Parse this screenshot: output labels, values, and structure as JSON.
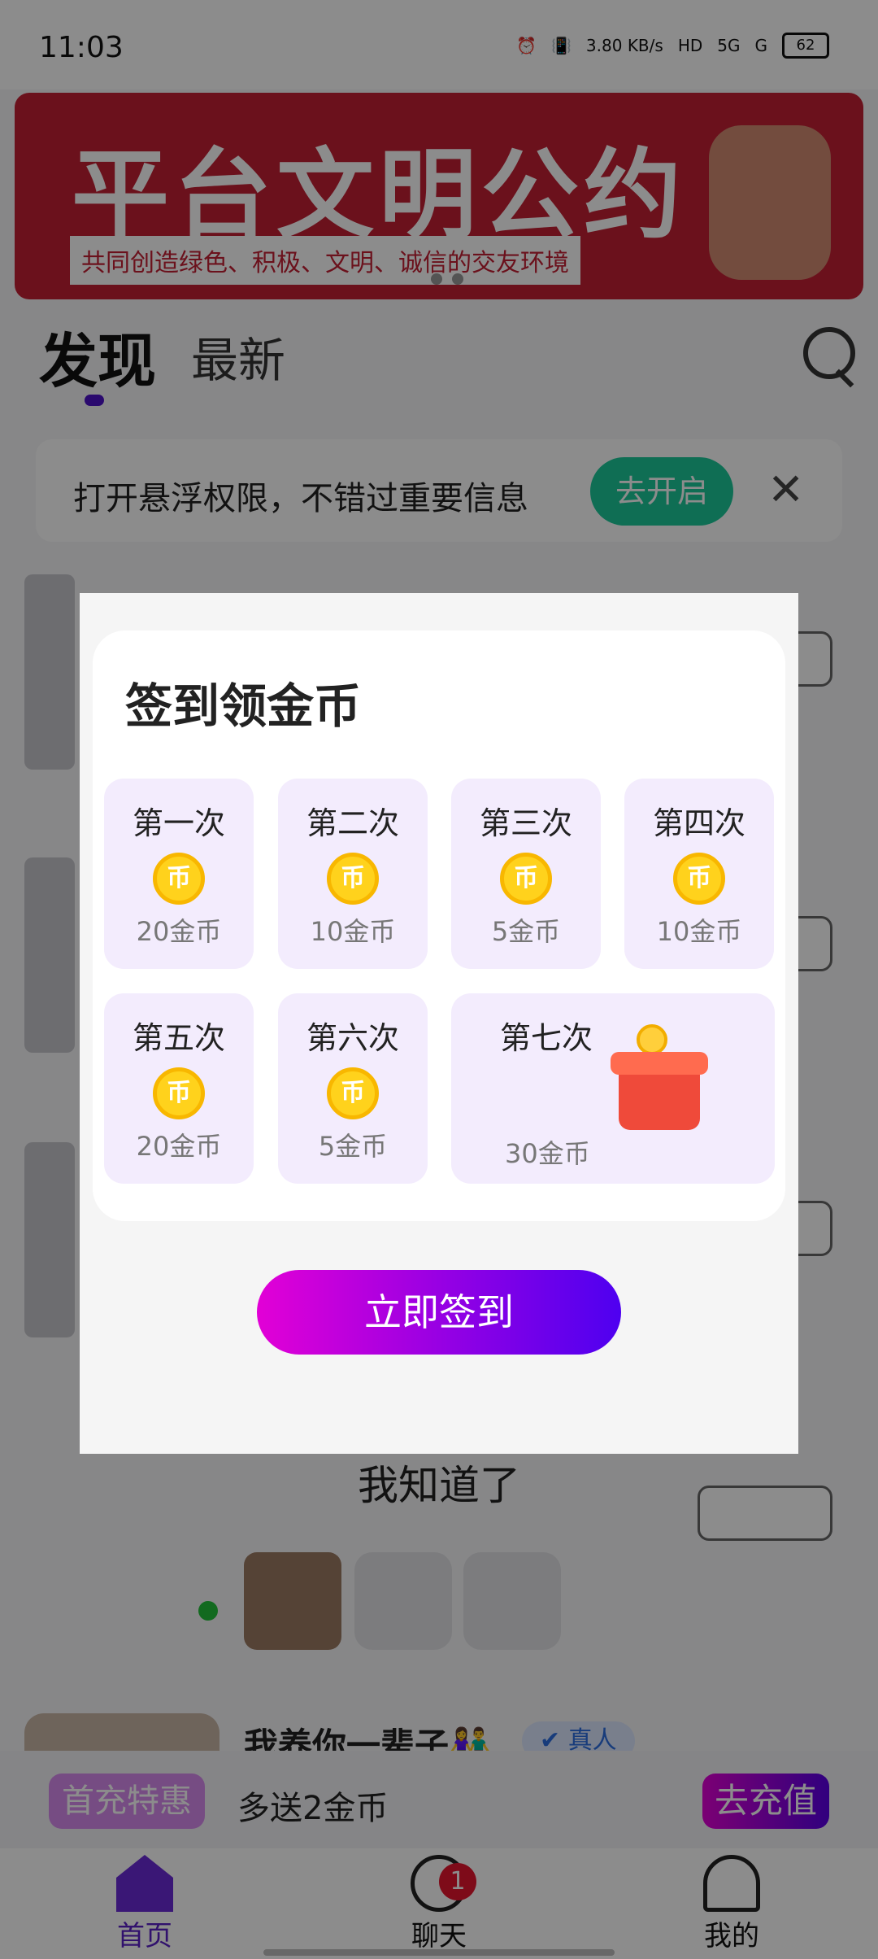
{
  "status_bar": {
    "time": "11:03",
    "speed": "3.80",
    "speed_unit": "KB/s",
    "net1": "5G",
    "net2": "G",
    "battery": "62"
  },
  "banner": {
    "title": "平台文明公约",
    "subtitle": "共同创造绿色、积极、文明、诚信的交友环境"
  },
  "tabs": {
    "discover": "发现",
    "latest": "最新"
  },
  "notice": {
    "text": "打开悬浮权限，不错过重要信息",
    "button": "去开启"
  },
  "background": {
    "know_text": "我知道了",
    "user_name": "我养你一辈子👫",
    "verified": "真人"
  },
  "recharge": {
    "tag": "首充特惠",
    "text": "多送2金币",
    "button": "去充值"
  },
  "nav": {
    "home": "首页",
    "chat": "聊天",
    "me": "我的",
    "chat_badge": "1"
  },
  "modal": {
    "title": "签到领金币",
    "coin_glyph": "币",
    "days": [
      {
        "label": "第一次",
        "amount": "20金币"
      },
      {
        "label": "第二次",
        "amount": "10金币"
      },
      {
        "label": "第三次",
        "amount": "5金币"
      },
      {
        "label": "第四次",
        "amount": "10金币"
      },
      {
        "label": "第五次",
        "amount": "20金币"
      },
      {
        "label": "第六次",
        "amount": "5金币"
      },
      {
        "label": "第七次",
        "amount": "30金币"
      }
    ],
    "sign_button": "立即签到"
  }
}
